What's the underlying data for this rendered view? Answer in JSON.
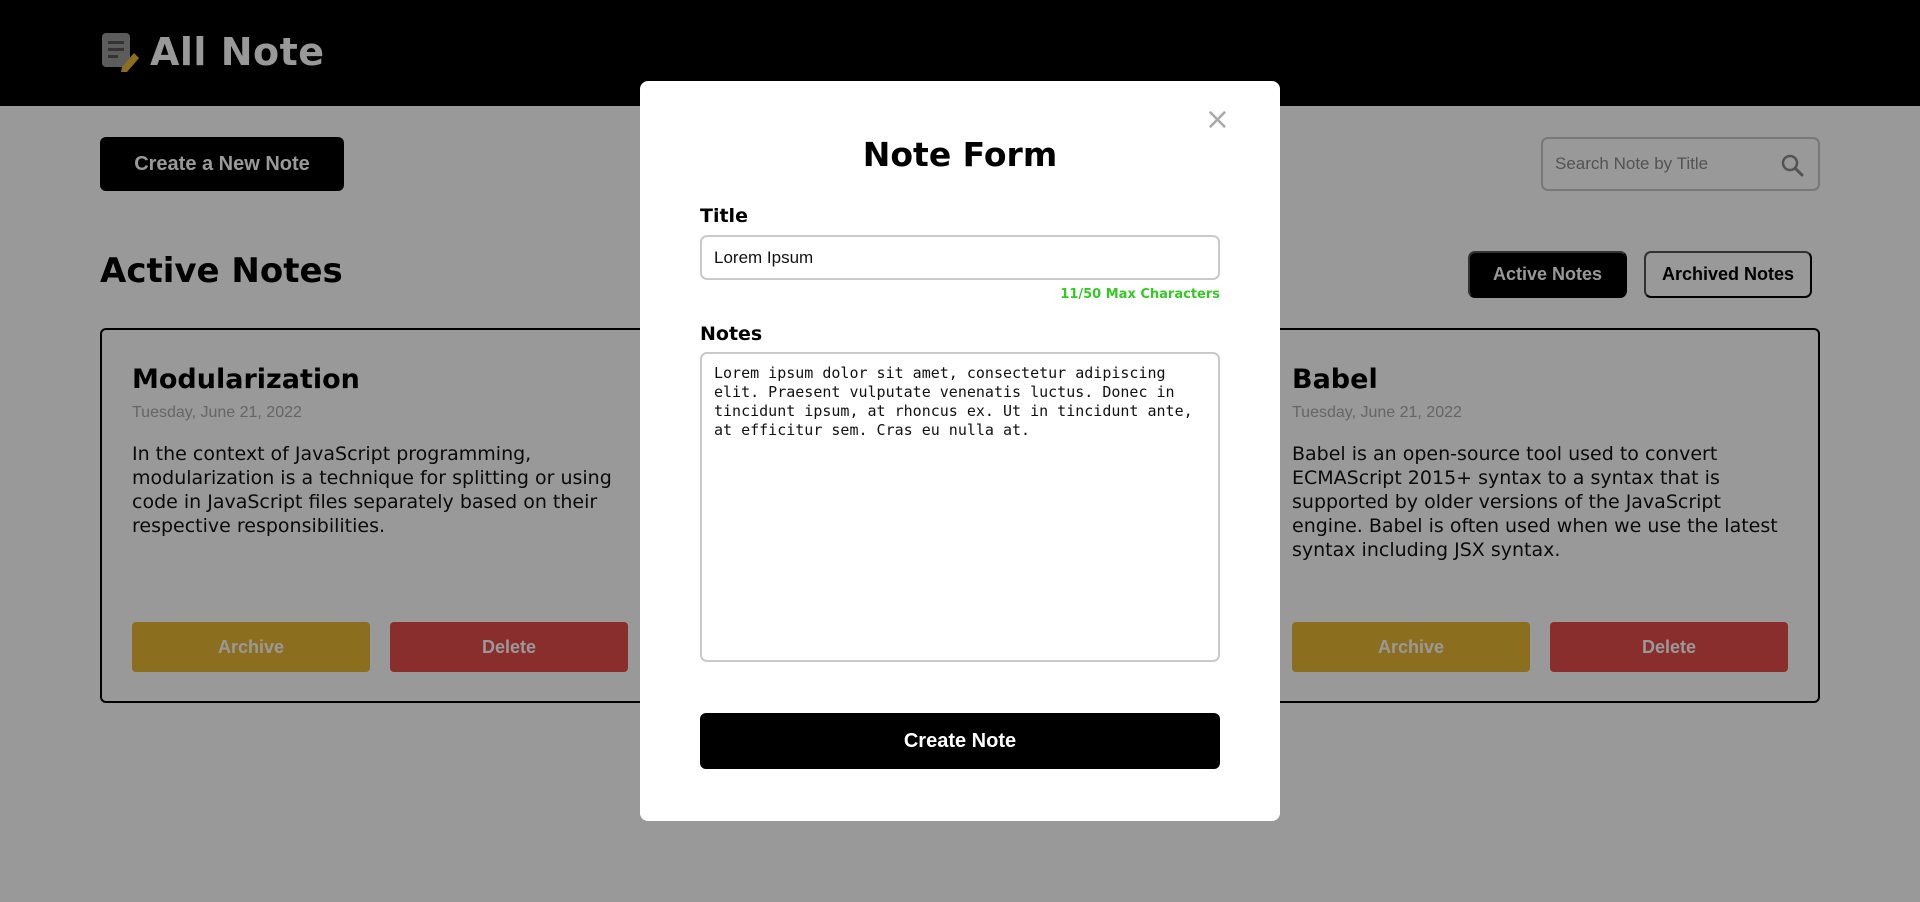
{
  "header": {
    "app_title": "All Note",
    "logo_icon": "note-pencil-icon",
    "accent_color": "#e8b833"
  },
  "toolbar": {
    "create_new_label": "Create a New Note",
    "search_placeholder": "Search Note by Title",
    "search_icon": "search-icon"
  },
  "section": {
    "title": "Active Notes",
    "tabs": [
      {
        "label": "Active Notes",
        "active": true
      },
      {
        "label": "Archived Notes",
        "active": false
      }
    ]
  },
  "notes": [
    {
      "title": "Modularization",
      "date": "Tuesday, June 21, 2022",
      "body": "In the context of JavaScript programming, modularization is a technique for splitting or using code in JavaScript files separately based on their respective responsibilities.",
      "archive_label": "Archive",
      "delete_label": "Delete"
    },
    {
      "title": "Babel",
      "date": "Tuesday, June 21, 2022",
      "body": "Babel is an open-source tool used to convert ECMAScript 2015+ syntax to a syntax that is supported by older versions of the JavaScript engine. Babel is often used when we use the latest syntax including JSX syntax.",
      "archive_label": "Archive",
      "delete_label": "Delete"
    }
  ],
  "modal": {
    "close_glyph": "×",
    "title": "Note Form",
    "title_label": "Title",
    "title_value": "Lorem Ipsum",
    "char_count": "11/50 Max Characters",
    "notes_label": "Notes",
    "notes_value": "Lorem ipsum dolor sit amet, consectetur adipiscing elit. Praesent vulputate venenatis luctus. Donec in tincidunt ipsum, at rhoncus ex. Ut in tincidunt ante, at efficitur sem. Cras eu nulla at.",
    "submit_label": "Create Note"
  },
  "colors": {
    "archive": "#e8b833",
    "delete": "#e64b4b",
    "char_count": "#34c924"
  }
}
